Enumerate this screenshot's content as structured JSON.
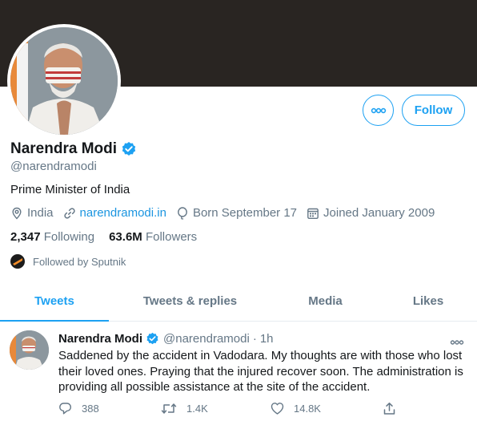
{
  "profile": {
    "name": "Narendra Modi",
    "handle": "@narendramodi",
    "bio": "Prime Minister of India",
    "location": "India",
    "website": "narendramodi.in",
    "birthday": "Born September 17",
    "joined": "Joined January 2009",
    "following_count": "2,347",
    "following_label": "Following",
    "followers_count": "63.6M",
    "followers_label": "Followers",
    "followed_by": "Followed by Sputnik"
  },
  "actions": {
    "follow_label": "Follow",
    "more_icon": "more-horizontal-icon"
  },
  "tabs": [
    {
      "label": "Tweets",
      "active": true
    },
    {
      "label": "Tweets & replies",
      "active": false
    },
    {
      "label": "Media",
      "active": false
    },
    {
      "label": "Likes",
      "active": false
    }
  ],
  "tweet": {
    "name": "Narendra Modi",
    "handle": "@narendramodi",
    "separator": "·",
    "time": "1h",
    "text": "Saddened by the accident in Vadodara. My thoughts are with those who lost their loved ones. Praying that the injured recover soon. The administration is providing all possible assistance at the site of the accident.",
    "replies": "388",
    "retweets": "1.4K",
    "likes": "14.8K"
  },
  "colors": {
    "accent": "#1da1f2",
    "link": "#1b95e0",
    "banner": "#292522",
    "muted": "#657786",
    "text": "#14171a"
  }
}
